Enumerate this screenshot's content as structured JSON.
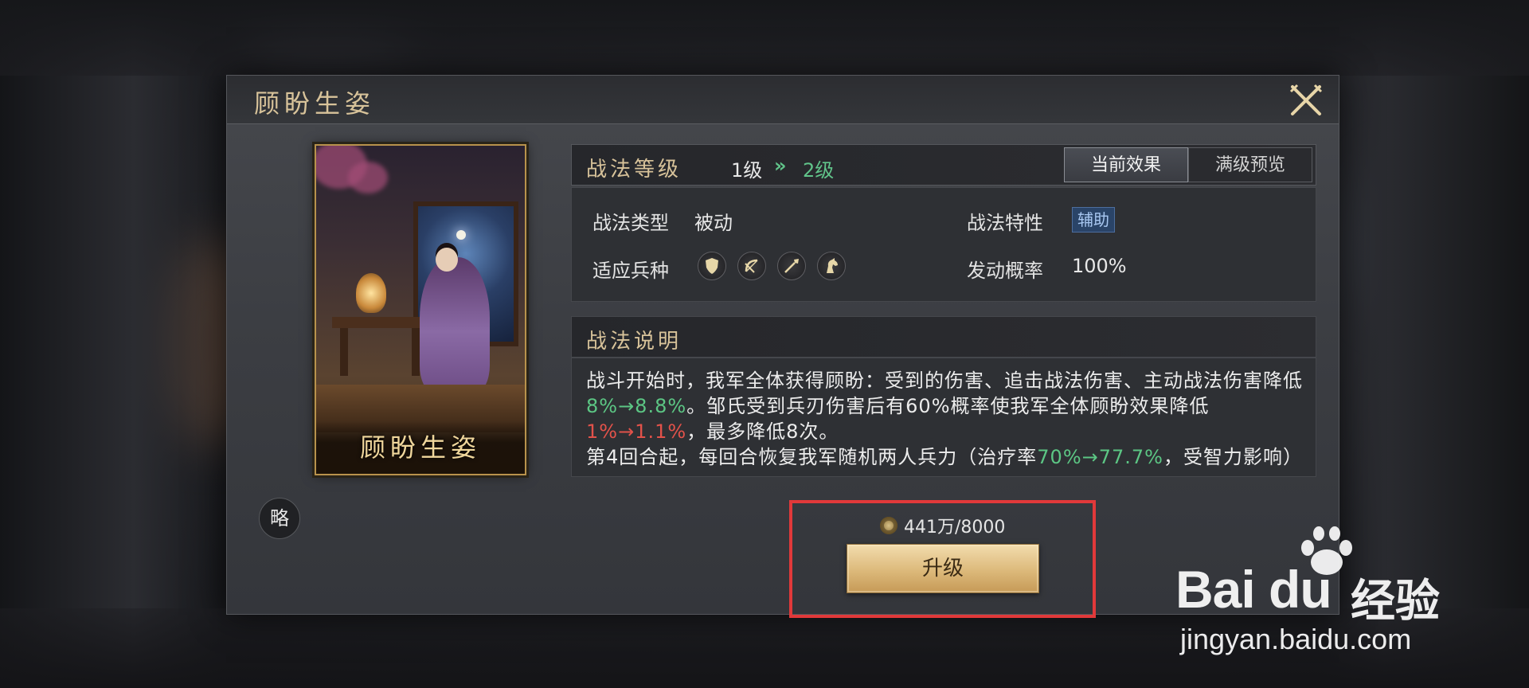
{
  "dialog": {
    "title": "顾盼生姿",
    "close_icon": "crossed-swords-close-icon"
  },
  "card": {
    "label": "顾盼生姿",
    "brief_button": "略"
  },
  "level": {
    "label": "战法等级",
    "current": "1级",
    "arrow": "»",
    "next": "2级"
  },
  "tabs": [
    {
      "label": "当前效果",
      "active": true
    },
    {
      "label": "满级预览",
      "active": false
    }
  ],
  "stats": {
    "type_label": "战法类型",
    "type_value": "被动",
    "trait_label": "战法特性",
    "trait_value": "辅助",
    "troops_label": "适应兵种",
    "troop_icons": [
      "shield-icon",
      "bow-icon",
      "spear-icon",
      "horse-icon"
    ],
    "rate_label": "发动概率",
    "rate_value": "100%"
  },
  "description": {
    "label": "战法说明",
    "p1_a": "战斗开始时，我军全体获得顾盼：受到的伤害、追击战法伤害、主动战法伤害降低",
    "p1_g": "8%→8.8%",
    "p1_b": "。邹氏受到兵刃伤害后有60%概率使我军全体顾盼效果降低",
    "p1_r": "1%→1.1%",
    "p1_c": "，最多降低8次。",
    "p2_a": "第4回合起，每回合恢复我军随机两人兵力（治疗率",
    "p2_g": "70%→77.7%",
    "p2_b": "，受智力影响）"
  },
  "upgrade": {
    "cost": "441万/8000",
    "button_label": "升级"
  },
  "watermark": {
    "brand": "Bai du",
    "cn": "经验",
    "url": "jingyan.baidu.com"
  },
  "colors": {
    "accent_gold": "#d8c39a",
    "value_green": "#5cc684",
    "value_red": "#e2524a",
    "highlight_red": "#e1393a"
  }
}
